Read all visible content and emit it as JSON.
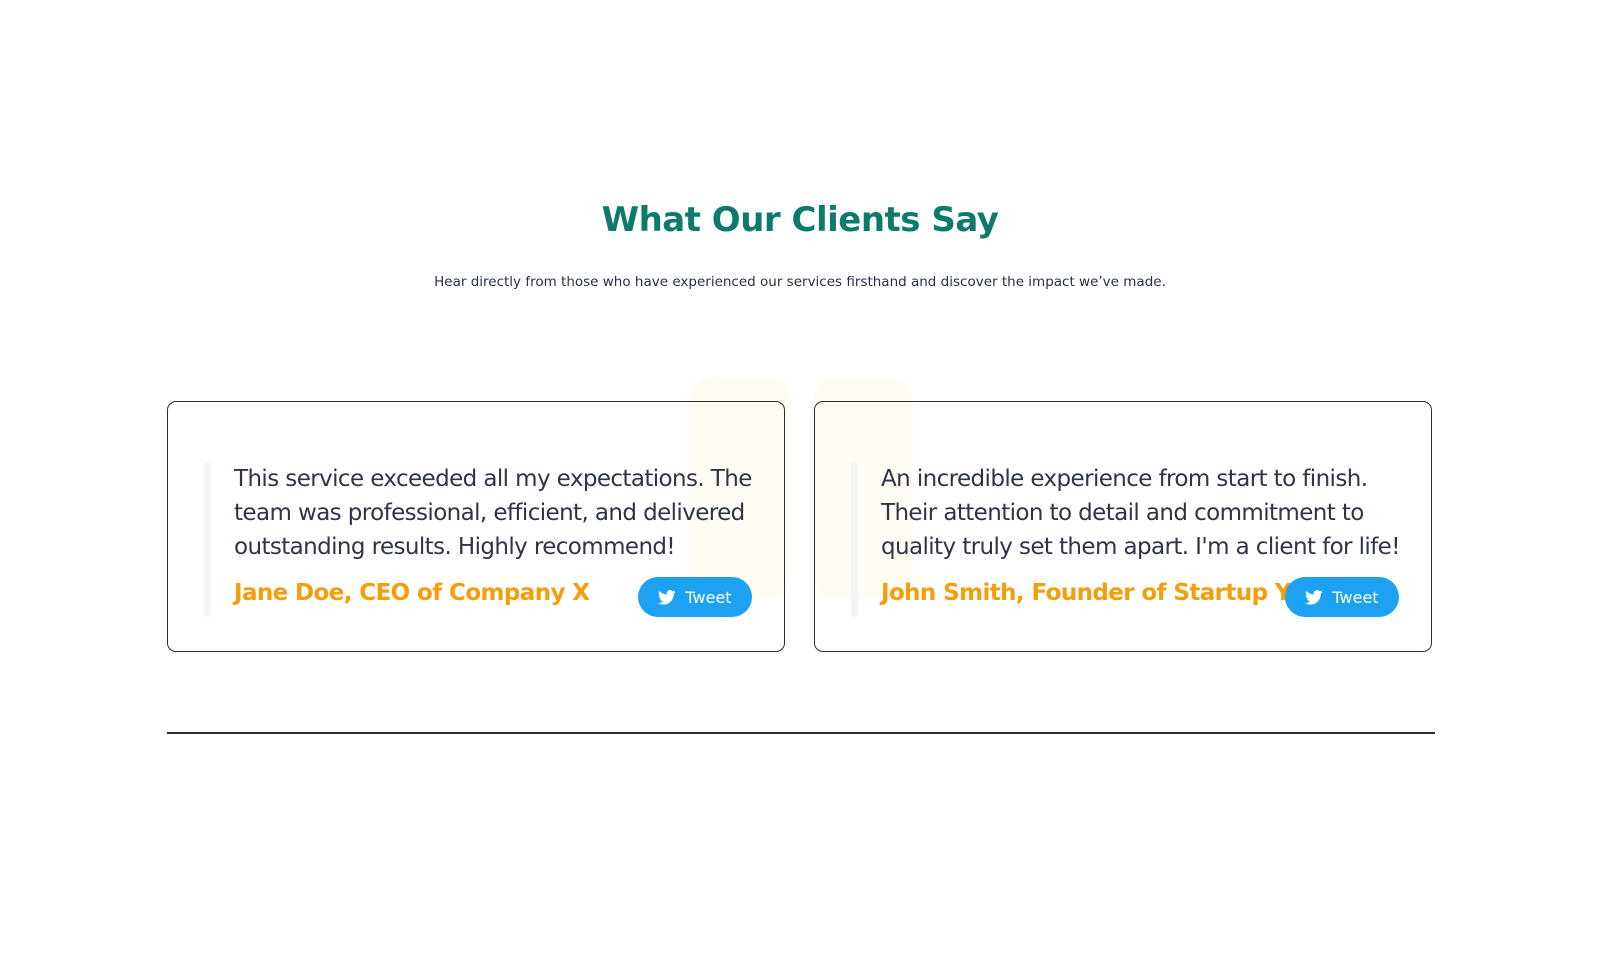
{
  "section": {
    "title": "What Our Clients Say",
    "subtitle": "Hear directly from those who have experienced our services firsthand and discover the impact we’ve made."
  },
  "testimonials": [
    {
      "quote": "This service exceeded all my expectations. The team was professional, efficient, and delivered outstanding results. Highly recommend!",
      "author": "Jane Doe, CEO of Company X",
      "tweet_label": "Tweet"
    },
    {
      "quote": "An incredible experience from start to finish. Their attention to detail and commitment to quality truly set them apart. I'm a client for life!",
      "author": "John Smith, Founder of Startup Y",
      "tweet_label": "Tweet"
    }
  ],
  "colors": {
    "title": "#0e7a6c",
    "author": "#f59e0b",
    "tweet_button": "#1da1f2",
    "text": "#2f3547"
  },
  "icons": {
    "tweet": "twitter-bird-icon",
    "background": "quote-mark-icon"
  }
}
